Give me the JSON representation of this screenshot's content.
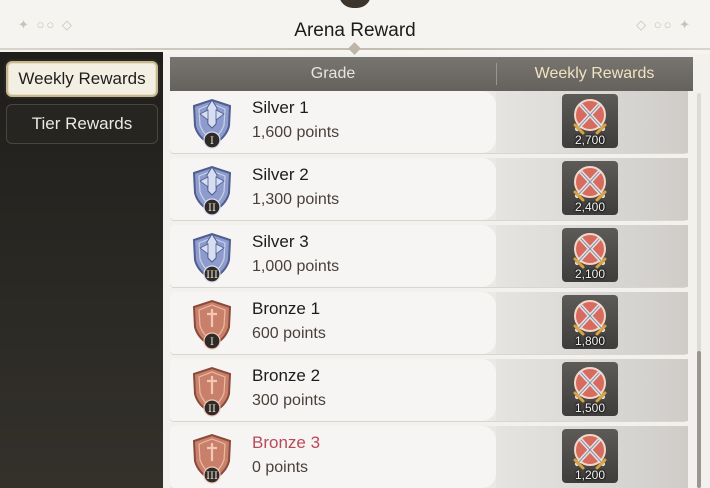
{
  "header": {
    "title": "Arena Reward"
  },
  "tabs": [
    {
      "label": "Weekly Rewards",
      "active": true
    },
    {
      "label": "Tier Rewards",
      "active": false
    }
  ],
  "table": {
    "columns": [
      "Grade",
      "Weekly Rewards"
    ],
    "rows": [
      {
        "name": "Silver 1",
        "points": "1,600 points",
        "tier": "silver",
        "numeral": "I",
        "reward": "2,700",
        "highlight": false
      },
      {
        "name": "Silver 2",
        "points": "1,300 points",
        "tier": "silver",
        "numeral": "II",
        "reward": "2,400",
        "highlight": false
      },
      {
        "name": "Silver 3",
        "points": "1,000 points",
        "tier": "silver",
        "numeral": "III",
        "reward": "2,100",
        "highlight": false
      },
      {
        "name": "Bronze 1",
        "points": "600 points",
        "tier": "bronze",
        "numeral": "I",
        "reward": "1,800",
        "highlight": false
      },
      {
        "name": "Bronze 2",
        "points": "300 points",
        "tier": "bronze",
        "numeral": "II",
        "reward": "1,500",
        "highlight": false
      },
      {
        "name": "Bronze 3",
        "points": "0 points",
        "tier": "bronze",
        "numeral": "III",
        "reward": "1,200",
        "highlight": true
      }
    ]
  },
  "icons": {
    "badge": "rank-shield-icon",
    "reward": "crossed-swords-icon"
  },
  "colors": {
    "highlight_text": "#b94a5a",
    "silver_badge": "#8d9ccc",
    "bronze_badge": "#c9806a",
    "weekly_header_text": "#efe2bf"
  }
}
